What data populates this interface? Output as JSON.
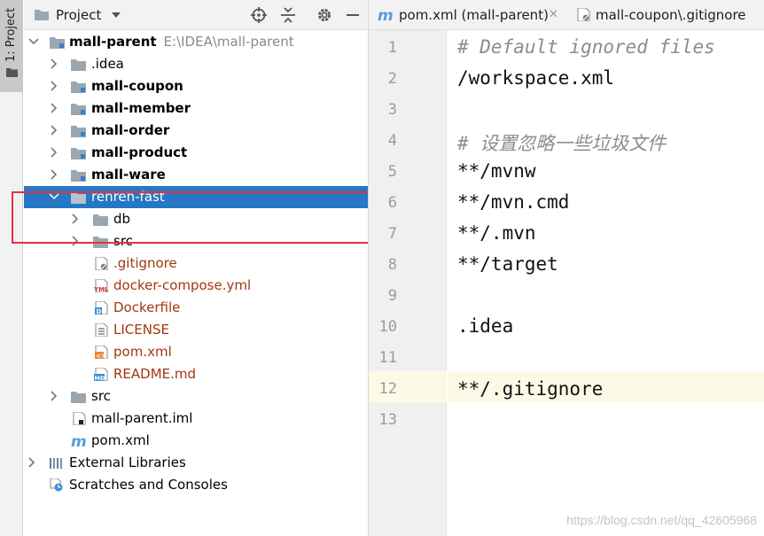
{
  "tool_strip": {
    "label": "1: Project"
  },
  "project_panel": {
    "title": "Project",
    "tree": [
      {
        "label": "mall-parent",
        "path": "E:\\IDEA\\mall-parent",
        "icon": "module-folder-icon",
        "bold": true,
        "expanded": true,
        "depth": 0
      },
      {
        "label": ".idea",
        "icon": "folder-icon",
        "bold": false,
        "expanded": false,
        "depth": 1
      },
      {
        "label": "mall-coupon",
        "icon": "module-folder-icon",
        "bold": true,
        "expanded": false,
        "depth": 1
      },
      {
        "label": "mall-member",
        "icon": "module-folder-icon",
        "bold": true,
        "expanded": false,
        "depth": 1
      },
      {
        "label": "mall-order",
        "icon": "module-folder-icon",
        "bold": true,
        "expanded": false,
        "depth": 1
      },
      {
        "label": "mall-product",
        "icon": "module-folder-icon",
        "bold": true,
        "expanded": false,
        "depth": 1
      },
      {
        "label": "mall-ware",
        "icon": "module-folder-icon",
        "bold": true,
        "expanded": false,
        "depth": 1
      },
      {
        "label": "renren-fast",
        "icon": "folder-icon",
        "bold": false,
        "expanded": true,
        "selected": true,
        "depth": 1
      },
      {
        "label": "db",
        "icon": "folder-icon",
        "expanded": false,
        "depth": 2
      },
      {
        "label": "src",
        "icon": "folder-icon",
        "expanded": false,
        "depth": 2
      },
      {
        "label": ".gitignore",
        "icon": "gitignore-file-icon",
        "brown": true,
        "depth": 2
      },
      {
        "label": "docker-compose.yml",
        "icon": "yml-file-icon",
        "brown": true,
        "depth": 2
      },
      {
        "label": "Dockerfile",
        "icon": "dockerfile-icon",
        "brown": true,
        "depth": 2
      },
      {
        "label": "LICENSE",
        "icon": "text-file-icon",
        "brown": true,
        "depth": 2
      },
      {
        "label": "pom.xml",
        "icon": "xml-file-icon",
        "brown": true,
        "depth": 2
      },
      {
        "label": "README.md",
        "icon": "markdown-file-icon",
        "brown": true,
        "depth": 2
      },
      {
        "label": "src",
        "icon": "folder-icon",
        "expanded": false,
        "depth": 1
      },
      {
        "label": "mall-parent.iml",
        "icon": "iml-file-icon",
        "depth": 1
      },
      {
        "label": "pom.xml",
        "icon": "maven-icon",
        "depth": 1
      },
      {
        "label": "External Libraries",
        "icon": "libraries-icon",
        "expanded": false,
        "depth": 0
      },
      {
        "label": "Scratches and Consoles",
        "icon": "scratches-icon",
        "depth": 0
      }
    ]
  },
  "editor": {
    "tabs": [
      {
        "label": "pom.xml (mall-parent)",
        "icon": "maven-icon"
      },
      {
        "label": "mall-coupon\\.gitignore",
        "icon": "gitignore-file-icon"
      }
    ],
    "current_line": 12,
    "lines": [
      {
        "n": "1",
        "text": "# Default ignored files",
        "comment": true
      },
      {
        "n": "2",
        "text": "/workspace.xml",
        "comment": false
      },
      {
        "n": "3",
        "text": "",
        "comment": false
      },
      {
        "n": "4",
        "text": "# 设置忽略一些垃圾文件",
        "comment": true
      },
      {
        "n": "5",
        "text": "**/mvnw",
        "comment": false
      },
      {
        "n": "6",
        "text": "**/mvn.cmd",
        "comment": false
      },
      {
        "n": "7",
        "text": "**/.mvn",
        "comment": false
      },
      {
        "n": "8",
        "text": "**/target",
        "comment": false
      },
      {
        "n": "9",
        "text": "",
        "comment": false
      },
      {
        "n": "10",
        "text": ".idea",
        "comment": false
      },
      {
        "n": "11",
        "text": "",
        "comment": false
      },
      {
        "n": "12",
        "text": "**/.gitignore",
        "comment": false
      },
      {
        "n": "13",
        "text": "",
        "comment": false
      }
    ]
  },
  "watermark": "https://blog.csdn.net/qq_42605968",
  "colors": {
    "selection": "#2677c4",
    "highlight_box": "#e3323f",
    "file_label": "#a0380f",
    "folder": "#9aa7b0"
  }
}
